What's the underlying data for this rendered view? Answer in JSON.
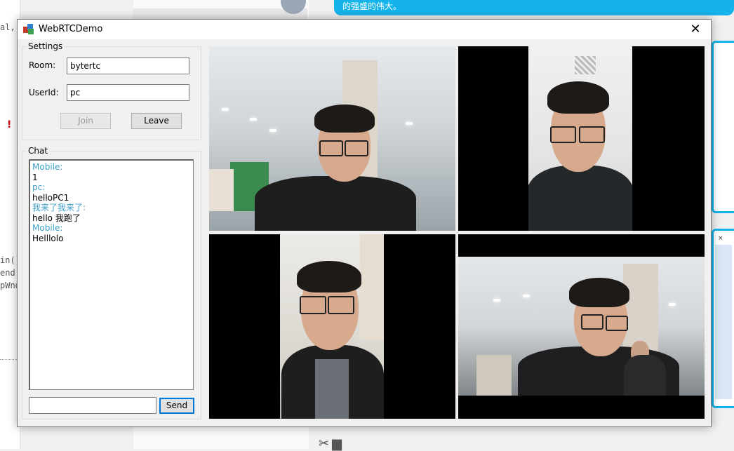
{
  "window": {
    "title": "WebRTCDemo",
    "close_label": "✕"
  },
  "settings": {
    "legend": "Settings",
    "room_label": "Room:",
    "room_value": "bytertc",
    "userid_label": "UserId:",
    "userid_value": "pc",
    "join_label": "Join",
    "leave_label": "Leave"
  },
  "chat": {
    "legend": "Chat",
    "messages": [
      {
        "sender": "Mobile:",
        "text": "1"
      },
      {
        "sender": "pc:",
        "text": "helloPC1"
      },
      {
        "sender": "我来了我来了:",
        "text": "hello 我跑了"
      },
      {
        "sender": "Mobile:",
        "text": "Helllolo"
      }
    ],
    "input_value": "",
    "send_label": "Send"
  },
  "background": {
    "banner_text": "的强盛的伟大。",
    "code_lines": [
      "al,",
      "in()",
      "end(",
      "pWnd"
    ]
  },
  "colors": {
    "accent": "#0078d7",
    "chat_sender": "#3da0c9",
    "banner": "#16b3ea"
  },
  "icons": {
    "app": "webrtc-app-icon",
    "close": "close-icon"
  }
}
